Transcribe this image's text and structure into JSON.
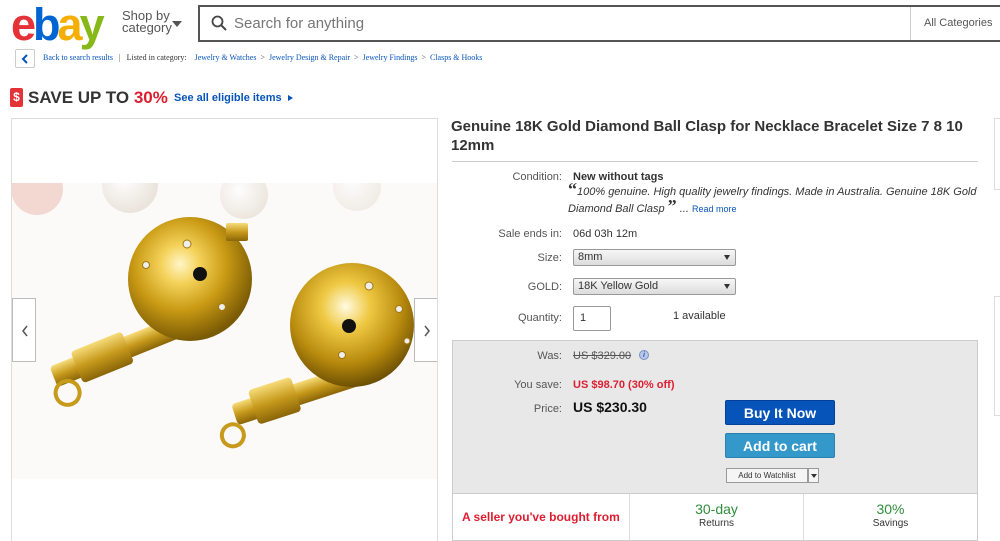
{
  "header": {
    "logo_letters": [
      "e",
      "b",
      "a",
      "y"
    ],
    "logo_colors": [
      "#e53238",
      "#0064d2",
      "#f5af02",
      "#86b817"
    ],
    "shop_by": [
      "Shop by",
      "category"
    ],
    "search_placeholder": "Search for anything",
    "category_select": "All Categories"
  },
  "breadcrumb": {
    "back": "Back to search results",
    "listed_in": "Listed in category:",
    "items": [
      "Jewelry & Watches",
      "Jewelry Design & Repair",
      "Jewelry Findings",
      "Clasps & Hooks"
    ]
  },
  "promo": {
    "tag": "$",
    "text": "SAVE UP TO ",
    "percent": "30%",
    "link": "See all eligible items"
  },
  "item": {
    "title": "Genuine 18K Gold Diamond Ball Clasp for Necklace Bracelet Size 7 8 10 12mm",
    "condition_label": "Condition:",
    "condition_value": "New without tags",
    "condition_description": "100% genuine. High quality jewelry findings. Made in Australia. Genuine 18K Gold Diamond Ball Clasp",
    "ellipsis": "...",
    "read_more": "Read more",
    "sale_label": "Sale ends in:",
    "sale_value": "06d 03h 12m",
    "size_label": "Size:",
    "size_value": "8mm",
    "gold_label": "GOLD:",
    "gold_value": "18K Yellow Gold",
    "quantity_label": "Quantity:",
    "quantity_value": "1",
    "available": "1 available"
  },
  "pricing": {
    "was_label": "Was:",
    "was_value": "US $329.00",
    "save_label": "You save:",
    "save_value": "US $98.70 (30% off)",
    "price_label": "Price:",
    "price_value": "US $230.30",
    "buy_now": "Buy It Now",
    "add_to_cart": "Add to cart",
    "watchlist": "Add to Watchlist"
  },
  "highlights": {
    "seller": "A seller you've bought from",
    "returns_big": "30-day",
    "returns_small": "Returns",
    "savings_big": "30%",
    "savings_small": "Savings"
  },
  "colors": {
    "link": "#0654ba",
    "accent_red": "#dd1e31",
    "buy_button": "#0654ba",
    "cart_button": "#3498ca",
    "highlight_green": "#2f8d3b"
  }
}
